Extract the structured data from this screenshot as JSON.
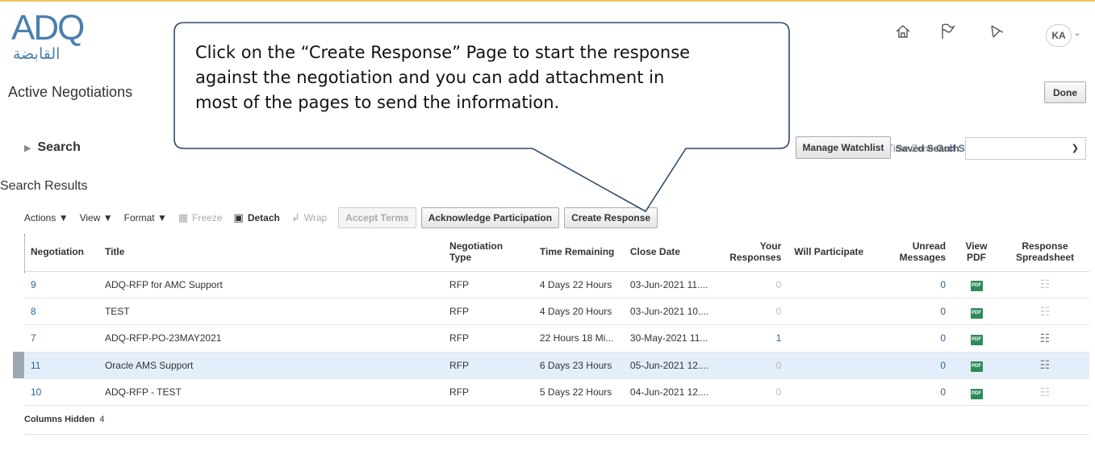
{
  "logo": {
    "latin": "ADQ",
    "arabic": "القابضة"
  },
  "page_title": "Active Negotiations",
  "header": {
    "icons": [
      "home-icon",
      "flag-icon",
      "bell-icon"
    ],
    "avatar": "KA",
    "done_label": "Done"
  },
  "timezone": {
    "prefix": "Time Zone",
    "value": "Gulf Standard Time"
  },
  "search": {
    "label": "Search",
    "manage_watchlist": "Manage Watchlist",
    "saved_search_label": "Saved Search",
    "saved_search_value": ""
  },
  "results_title": "Search Results",
  "toolbar": {
    "actions": "Actions",
    "view": "View",
    "format": "Format",
    "freeze": "Freeze",
    "detach": "Detach",
    "wrap": "Wrap",
    "accept_terms": "Accept Terms",
    "acknowledge": "Acknowledge Participation",
    "create_response": "Create Response"
  },
  "table": {
    "headers": [
      "Negotiation",
      "Title",
      "Negotiation Type",
      "Time Remaining",
      "Close Date",
      "Your Responses",
      "Will Participate",
      "Unread Messages",
      "View PDF",
      "Response Spreadsheet"
    ],
    "rows": [
      {
        "negotiation": "9",
        "title": "ADQ-RFP for AMC Support",
        "type": "RFP",
        "time": "4 Days 22 Hours",
        "close": "03-Jun-2021 11....",
        "responses": "0",
        "will": "",
        "unread": "0",
        "pdf": "PDF"
      },
      {
        "negotiation": "8",
        "title": "TEST",
        "type": "RFP",
        "time": "4 Days 20 Hours",
        "close": "03-Jun-2021 10....",
        "responses": "0",
        "will": "",
        "unread": "0",
        "pdf": "PDF"
      },
      {
        "negotiation": "7",
        "title": "ADQ-RFP-PO-23MAY2021",
        "type": "RFP",
        "time": "22 Hours 18 Mi...",
        "close": "30-May-2021 11...",
        "responses": "1",
        "will": "",
        "unread": "0",
        "pdf": "PDF"
      },
      {
        "negotiation": "11",
        "title": "Oracle AMS Support",
        "type": "RFP",
        "time": "6 Days 23 Hours",
        "close": "05-Jun-2021 12....",
        "responses": "0",
        "will": "",
        "unread": "0",
        "pdf": "PDF"
      },
      {
        "negotiation": "10",
        "title": "ADQ-RFP - TEST",
        "type": "RFP",
        "time": "5 Days 22 Hours",
        "close": "04-Jun-2021 12....",
        "responses": "0",
        "will": "",
        "unread": "0",
        "pdf": "PDF"
      }
    ]
  },
  "columns_hidden": {
    "label": "Columns Hidden",
    "count": "4"
  },
  "callout": {
    "line1": "Click on the “Create Response” Page to start the response",
    "line2": "against the negotiation and you can add attachment in",
    "line3": "most of the pages to send the information."
  }
}
